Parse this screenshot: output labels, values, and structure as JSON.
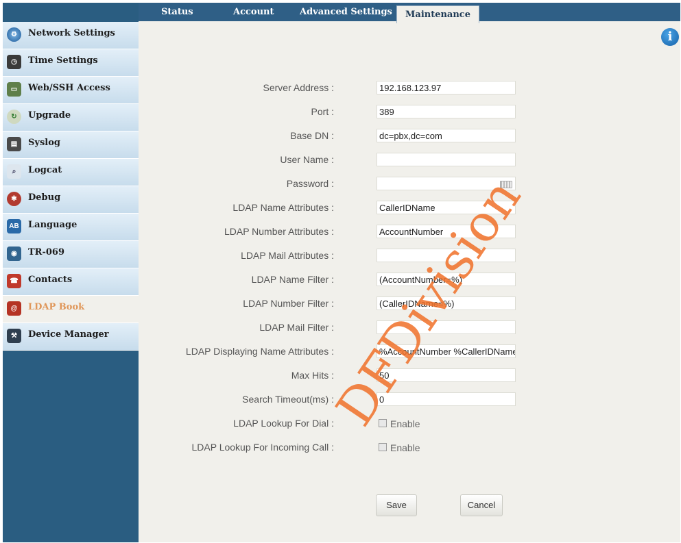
{
  "tabs": [
    "Status",
    "Account",
    "Advanced Settings",
    "Maintenance"
  ],
  "active_tab": "Maintenance",
  "sidebar": {
    "items": [
      {
        "label": "Network Settings",
        "icon": "network-icon"
      },
      {
        "label": "Time Settings",
        "icon": "clock-icon"
      },
      {
        "label": "Web/SSH Access",
        "icon": "monitor-icon"
      },
      {
        "label": "Upgrade",
        "icon": "upgrade-icon"
      },
      {
        "label": "Syslog",
        "icon": "syslog-icon"
      },
      {
        "label": "Logcat",
        "icon": "magnifier-icon"
      },
      {
        "label": "Debug",
        "icon": "bug-icon"
      },
      {
        "label": "Language",
        "icon": "language-icon"
      },
      {
        "label": "TR-069",
        "icon": "tr069-icon"
      },
      {
        "label": "Contacts",
        "icon": "contacts-icon"
      },
      {
        "label": "LDAP Book",
        "icon": "ldap-book-icon"
      },
      {
        "label": "Device Manager",
        "icon": "device-manager-icon"
      }
    ],
    "active": "LDAP Book"
  },
  "form": {
    "server_address": {
      "label": "Server Address :",
      "value": "192.168.123.97"
    },
    "port": {
      "label": "Port :",
      "value": "389"
    },
    "base_dn": {
      "label": "Base DN :",
      "value": "dc=pbx,dc=com"
    },
    "user_name": {
      "label": "User Name :",
      "value": ""
    },
    "password": {
      "label": "Password :",
      "value": ""
    },
    "ldap_name_attributes": {
      "label": "LDAP Name Attributes :",
      "value": "CallerIDName"
    },
    "ldap_number_attributes": {
      "label": "LDAP Number Attributes :",
      "value": "AccountNumber"
    },
    "ldap_mail_attributes": {
      "label": "LDAP Mail Attributes :",
      "value": ""
    },
    "ldap_name_filter": {
      "label": "LDAP Name Filter :",
      "value": "(AccountNumber=%)"
    },
    "ldap_number_filter": {
      "label": "LDAP Number Filter :",
      "value": "(CallerIDName=%)"
    },
    "ldap_mail_filter": {
      "label": "LDAP Mail Filter :",
      "value": ""
    },
    "ldap_displaying_name_attributes": {
      "label": "LDAP Displaying Name Attributes :",
      "value": "%AccountNumber %CallerIDName"
    },
    "max_hits": {
      "label": "Max Hits :",
      "value": "50"
    },
    "search_timeout": {
      "label": "Search Timeout(ms) :",
      "value": "0"
    },
    "lookup_for_dial": {
      "label": "LDAP Lookup For Dial :",
      "checkbox_label": "Enable",
      "checked": false
    },
    "lookup_for_incoming": {
      "label": "LDAP Lookup For Incoming Call :",
      "checkbox_label": "Enable",
      "checked": false
    }
  },
  "buttons": {
    "save": "Save",
    "cancel": "Cancel"
  },
  "watermark": "DFDivision",
  "colors": {
    "sidebar_bg": "#2a5d81",
    "tabbar_bg": "#2f5f86",
    "active_nav_text": "#e0975a",
    "watermark": "#f07028"
  }
}
